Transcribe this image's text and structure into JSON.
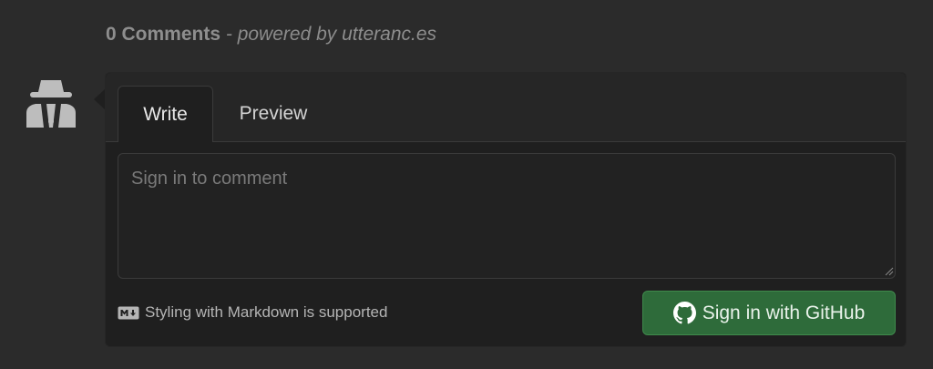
{
  "header": {
    "comment_count": "0 Comments",
    "separator": " - ",
    "powered_by": "powered by",
    "powered_link": "utteranc.es"
  },
  "avatar": {
    "icon": "incognito-user-icon"
  },
  "tabs": [
    {
      "label": "Write",
      "active": true
    },
    {
      "label": "Preview",
      "active": false
    }
  ],
  "comment": {
    "value": "",
    "placeholder": "Sign in to comment"
  },
  "markdown_note": {
    "icon": "markdown-icon",
    "text": "Styling with Markdown is supported"
  },
  "sign_in_button": {
    "icon": "github-icon",
    "label": "Sign in with GitHub"
  },
  "colors": {
    "page_background": "#2b2b2b",
    "box_background": "#1f1f1f",
    "button_background": "#2e6b3a",
    "button_border": "#3f8a4c"
  }
}
